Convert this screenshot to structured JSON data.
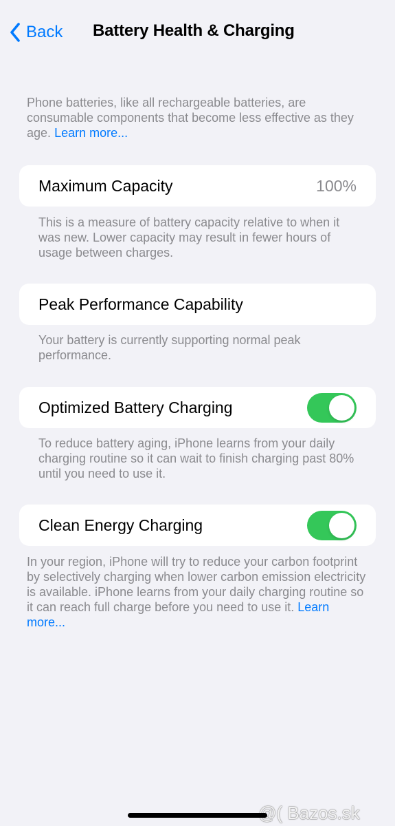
{
  "nav": {
    "back_label": "Back",
    "title": "Battery Health & Charging"
  },
  "intro": {
    "text": "Phone batteries, like all rechargeable batteries, are consumable components that become less effective as they age.",
    "link": "Learn more..."
  },
  "max_capacity": {
    "label": "Maximum Capacity",
    "value": "100%",
    "description": "This is a measure of battery capacity relative to when it was new. Lower capacity may result in fewer hours of usage between charges."
  },
  "peak_performance": {
    "label": "Peak Performance Capability",
    "description": "Your battery is currently supporting normal peak performance."
  },
  "optimized_charging": {
    "label": "Optimized Battery Charging",
    "enabled": true,
    "description": "To reduce battery aging, iPhone learns from your daily charging routine so it can wait to finish charging past 80% until you need to use it."
  },
  "clean_energy": {
    "label": "Clean Energy Charging",
    "enabled": true,
    "description": "In your region, iPhone will try to reduce your carbon footprint by selectively charging when lower carbon emission electricity is available. iPhone learns from your daily charging routine so it can reach full charge before you need to use it.",
    "link": "Learn more..."
  },
  "watermark": "@( Bazos.sk",
  "colors": {
    "accent": "#007aff",
    "toggle_on": "#34c759",
    "background": "#f2f2f7",
    "secondary_text": "#8a8a8e"
  }
}
